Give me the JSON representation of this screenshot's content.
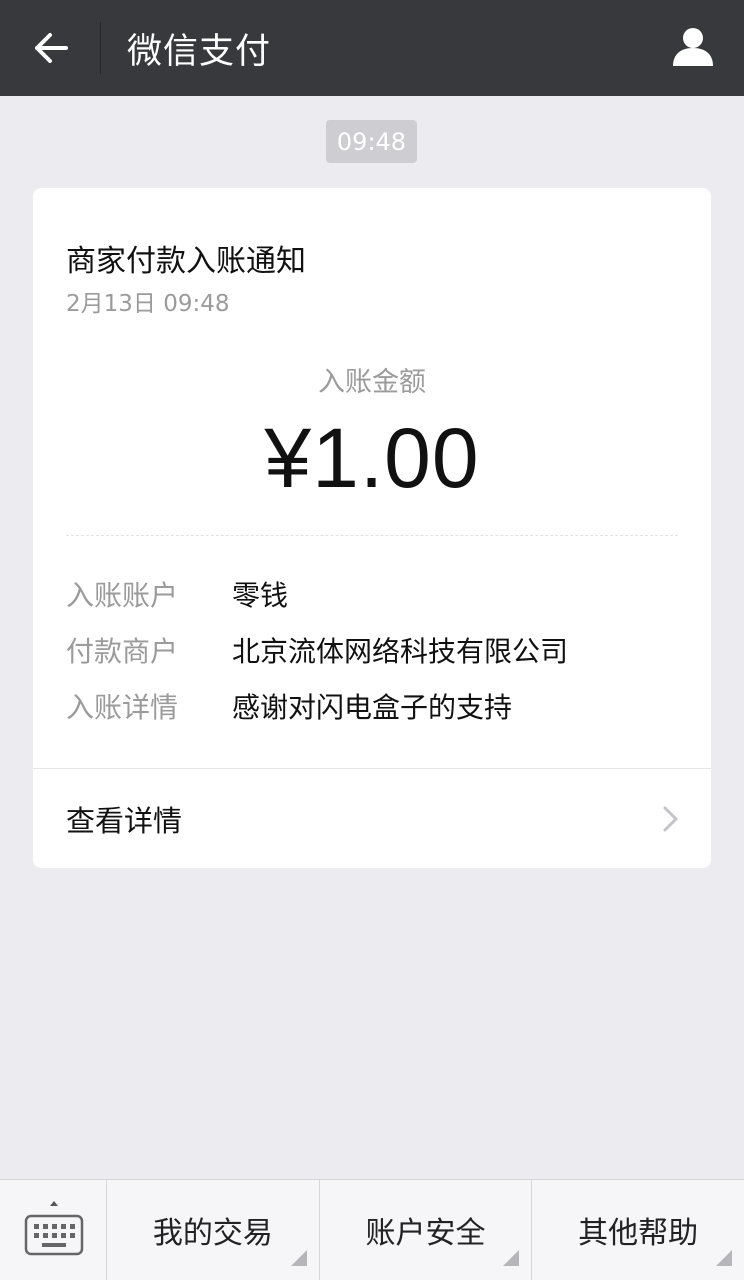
{
  "header": {
    "title": "微信支付",
    "back_icon": "back-arrow-icon",
    "profile_icon": "user-icon"
  },
  "timestamp": "09:48",
  "card": {
    "title": "商家付款入账通知",
    "date": "2月13日  09:48",
    "amount_label": "入账金额",
    "amount": "¥1.00",
    "details": [
      {
        "label": "入账账户",
        "value": "零钱"
      },
      {
        "label": "付款商户",
        "value": "北京流体网络科技有限公司"
      },
      {
        "label": "入账详情",
        "value": "感谢对闪电盒子的支持"
      }
    ],
    "view_details_label": "查看详情"
  },
  "bottom_bar": {
    "keyboard_icon": "keyboard-icon",
    "menu": [
      {
        "label": "我的交易"
      },
      {
        "label": "账户安全"
      },
      {
        "label": "其他帮助"
      }
    ]
  },
  "colors": {
    "header_bg": "#38393d",
    "page_bg": "#ebebf0",
    "card_bg": "#ffffff",
    "muted_text": "#9b9b9b"
  }
}
